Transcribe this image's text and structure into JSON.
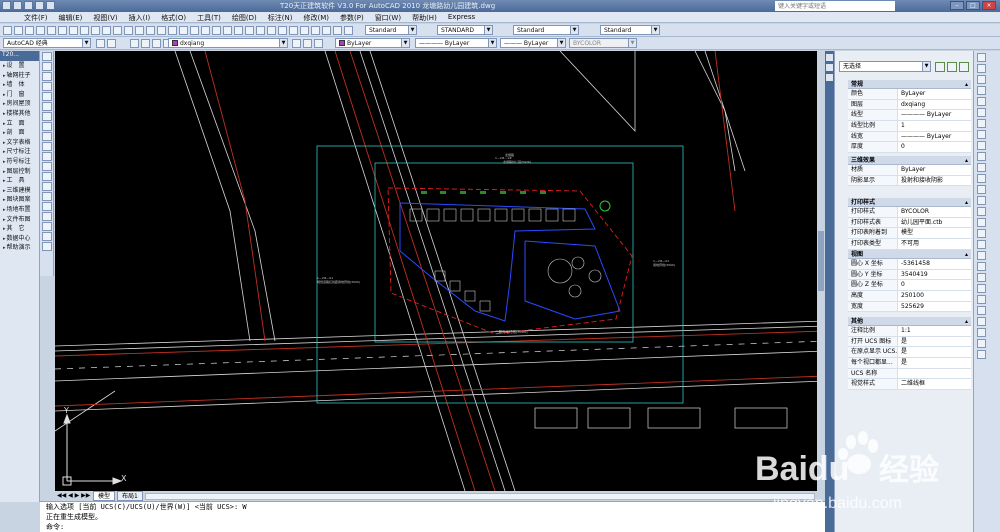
{
  "window": {
    "title": "T20天正建筑软件 V3.0 For AutoCAD 2010    龙塘路幼儿园建筑.dwg",
    "search_placeholder": "键入关键字或短语"
  },
  "menu": [
    "文件(F)",
    "编辑(E)",
    "视图(V)",
    "插入(I)",
    "格式(O)",
    "工具(T)",
    "绘图(D)",
    "标注(N)",
    "修改(M)",
    "参数(P)",
    "窗口(W)",
    "帮助(H)",
    "Express"
  ],
  "toolbar1": {
    "text_style": "Standard",
    "dim_style": "STANDARD",
    "table_style": "Standard",
    "mleader_style": "Standard"
  },
  "toolbar2": {
    "workspace": "AutoCAD 经典",
    "layer": "dxqiang",
    "color": "ByLayer",
    "linetype": "ByLayer",
    "lineweight": "ByLayer",
    "plotstyle": "BYCOLOR"
  },
  "left_panel": {
    "title": "T20...",
    "items": [
      "设　置",
      "轴网柱子",
      "墙　体",
      "门　窗",
      "房间屋顶",
      "楼梯其他",
      "立　面",
      "剖　面",
      "文字表格",
      "尺寸标注",
      "符号标注",
      "图层控制",
      "工　具",
      "三维建模",
      "图块图案",
      "场地布置",
      "文件布图",
      "其　它",
      "数据中心",
      "帮助演示"
    ]
  },
  "canvas": {
    "road_label_top": "龙塘路",
    "site_label": "1—2#—1#",
    "site_sub": "龙塘路幼儿园(5926)",
    "left_label": "1—2#—01",
    "left_sub": "规划道路红线距用地界线(3000)",
    "right_label": "1—2#—01",
    "right_sub": "用地界线(3000)",
    "bottom_label": "二期用地红线(3000)"
  },
  "tabs": [
    "模型",
    "布局1"
  ],
  "command": {
    "line1": "输入选项 [当前 UCS(C)/UCS(U)/世界(W)] <当前 UCS>: W",
    "line2": "正在重生成模型。",
    "prompt": "命令:"
  },
  "properties": {
    "selection": "无选择",
    "sections": [
      {
        "title": "常规",
        "rows": [
          [
            "颜色",
            "ByLayer"
          ],
          [
            "图层",
            "dxqiang"
          ],
          [
            "线型",
            "———— ByLayer"
          ],
          [
            "线型比例",
            "1"
          ],
          [
            "线宽",
            "———— ByLayer"
          ],
          [
            "厚度",
            "0"
          ]
        ]
      },
      {
        "title": "三维效果",
        "rows": [
          [
            "材质",
            "ByLayer"
          ],
          [
            "阴影显示",
            "投射和接收阴影"
          ]
        ]
      },
      {
        "title": "打印样式",
        "rows": [
          [
            "打印样式",
            "BYCOLOR"
          ],
          [
            "打印样式表",
            "幼儿园平面.ctb"
          ],
          [
            "打印表附着到",
            "模型"
          ],
          [
            "打印表类型",
            "不可用"
          ]
        ]
      },
      {
        "title": "视图",
        "rows": [
          [
            "圆心 X 坐标",
            "-5361458"
          ],
          [
            "圆心 Y 坐标",
            "3540419"
          ],
          [
            "圆心 Z 坐标",
            "0"
          ],
          [
            "高度",
            "250100"
          ],
          [
            "宽度",
            "525629"
          ]
        ]
      },
      {
        "title": "其他",
        "rows": [
          [
            "注释比例",
            "1:1"
          ],
          [
            "打开 UCS 图标",
            "是"
          ],
          [
            "在原点显示 UCS...",
            "是"
          ],
          [
            "每个视口都显...",
            "是"
          ],
          [
            "UCS 名称",
            ""
          ],
          [
            "视觉样式",
            "二维线框"
          ]
        ]
      }
    ]
  },
  "watermark": {
    "brand": "Baidu",
    "cn": "经验",
    "url": "jingyan.baidu.com"
  },
  "colors": {
    "accent": "#4a6a98",
    "canvas": "#000000",
    "layer_swatch": "#b03cc0"
  }
}
